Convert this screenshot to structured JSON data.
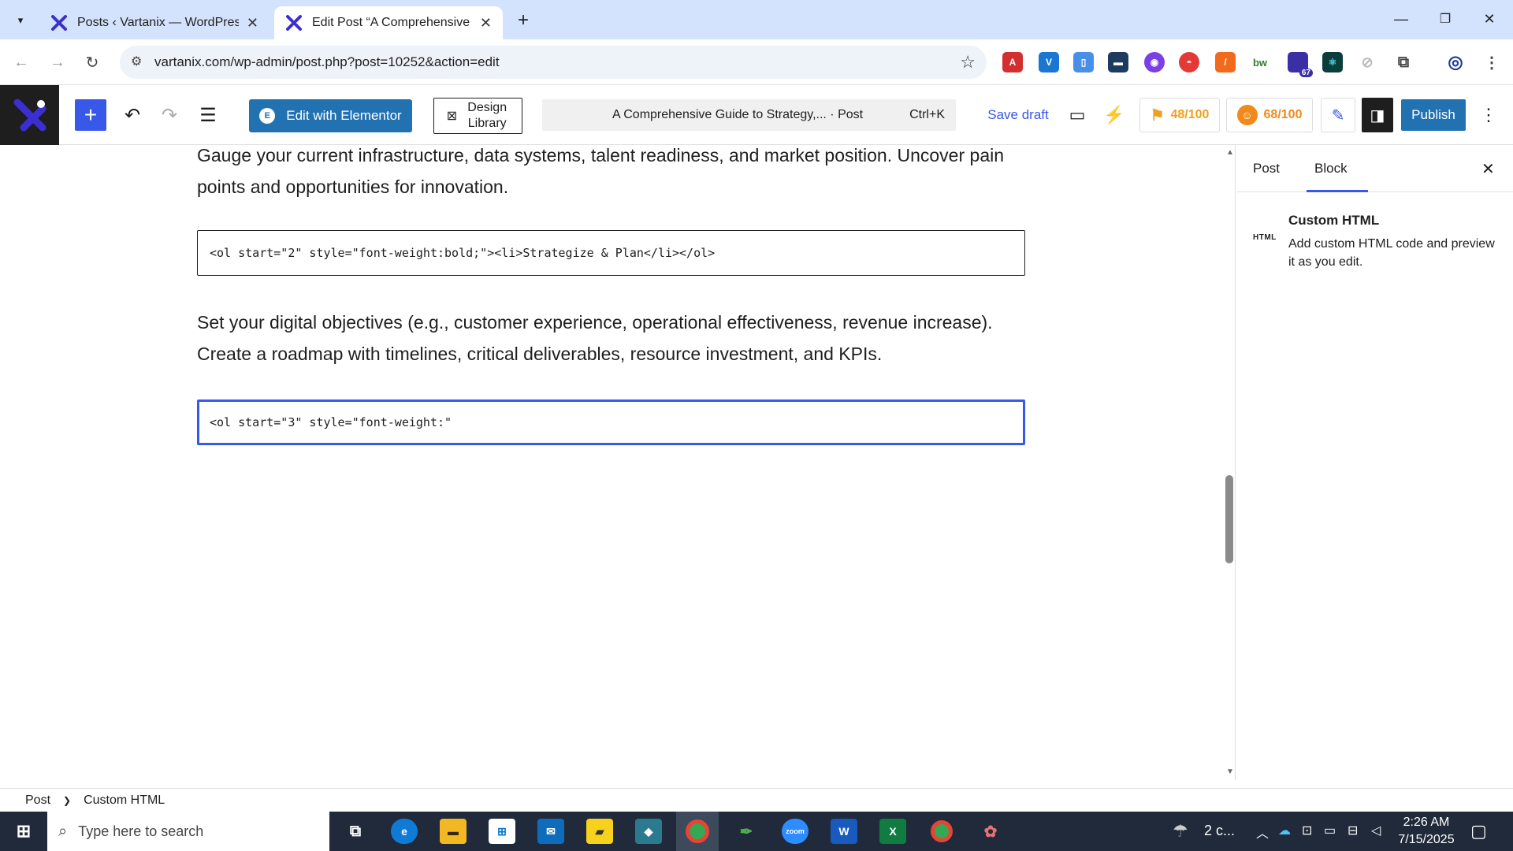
{
  "browser": {
    "tabs": [
      {
        "title": "Posts ‹ Vartanix — WordPress",
        "active": false
      },
      {
        "title": "Edit Post “A Comprehensive Gu",
        "active": true
      }
    ],
    "url": "vartanix.com/wp-admin/post.php?post=10252&action=edit",
    "extension_badge": "67"
  },
  "editor": {
    "elementor_label": "Edit with Elementor",
    "design_library_label": "Design Library",
    "command_bar": {
      "title": "A Comprehensive Guide to Strategy,... · Post",
      "shortcut": "Ctrl+K"
    },
    "save_draft": "Save draft",
    "score_seo": "48/100",
    "score_readability": "68/100",
    "publish": "Publish"
  },
  "content": {
    "para1": "Gauge your current infrastructure, data systems, talent readiness, and market position. Uncover pain points and opportunities for innovation.",
    "code1": "<ol start=\"2\" style=\"font-weight:bold;\"><li>Strategize & Plan</li></ol>",
    "para2": "Set your digital objectives (e.g., customer experience, operational effectiveness, revenue increase). Create a roadmap with timelines, critical deliverables, resource investment, and KPIs.",
    "code2": "<ol start=\"3\" style=\"font-weight:\""
  },
  "sidebar": {
    "tab_post": "Post",
    "tab_block": "Block",
    "block_icon_text": "HTML",
    "block_title": "Custom HTML",
    "block_desc": "Add custom HTML code and preview it as you edit."
  },
  "breadcrumbs": {
    "root": "Post",
    "current": "Custom HTML"
  },
  "taskbar": {
    "search_placeholder": "Type here to search",
    "weather": "2 c...",
    "time": "2:26 AM",
    "date": "7/15/2025"
  },
  "colors": {
    "wp_blue": "#3858e9",
    "publish_blue": "#2271b1",
    "tab_strip": "#d3e3fd",
    "taskbar": "#202a3a"
  }
}
